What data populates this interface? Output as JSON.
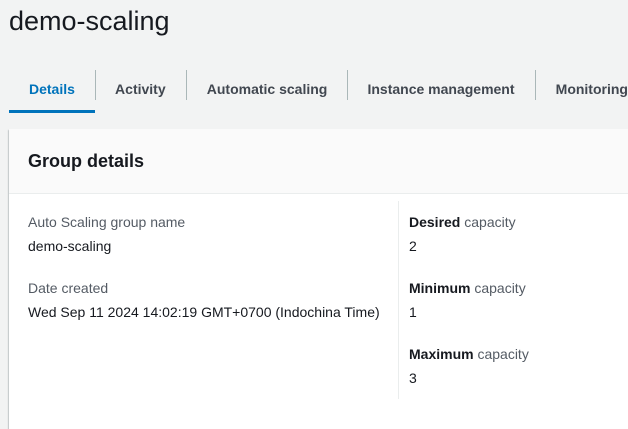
{
  "page": {
    "title": "demo-scaling"
  },
  "tabs": [
    {
      "label": "Details",
      "active": true
    },
    {
      "label": "Activity",
      "active": false
    },
    {
      "label": "Automatic scaling",
      "active": false
    },
    {
      "label": "Instance management",
      "active": false
    },
    {
      "label": "Monitoring",
      "active": false
    }
  ],
  "group_details": {
    "title": "Group details",
    "name_label": "Auto Scaling group name",
    "name_value": "demo-scaling",
    "date_label": "Date created",
    "date_value": "Wed Sep 11 2024 14:02:19 GMT+0700 (Indochina Time)",
    "desired_label_bold": "Desired",
    "desired_label_rest": " capacity",
    "desired_value": "2",
    "minimum_label_bold": "Minimum",
    "minimum_label_rest": " capacity",
    "minimum_value": "1",
    "maximum_label_bold": "Maximum",
    "maximum_label_rest": " capacity",
    "maximum_value": "3"
  },
  "colors": {
    "accent": "#0073bb",
    "text": "#16191f",
    "label": "#545b64",
    "background": "#f2f3f3"
  }
}
